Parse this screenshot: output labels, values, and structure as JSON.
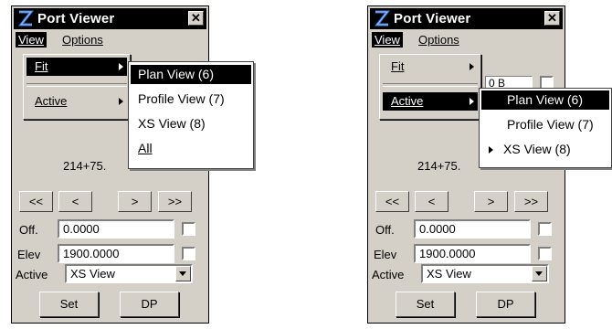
{
  "app": {
    "title": "Port Viewer",
    "close_glyph": "✕",
    "icon": "port-viewer-logo-icon"
  },
  "menu": {
    "view": "View",
    "options": "Options"
  },
  "view_menu": {
    "fit": "Fit",
    "active": "Active"
  },
  "submenu": {
    "plan": "Plan View (6)",
    "profile": "Profile View (7)",
    "xs": "XS View (8)",
    "all": "All"
  },
  "station_value": "214+75.",
  "partial_field_text": "0 B",
  "nav": {
    "first": "<<",
    "prev": "<",
    "next": ">",
    "last": ">>"
  },
  "offset": {
    "label": "Off.",
    "value": "0.0000"
  },
  "elevation": {
    "label": "Elev",
    "value": "1900.0000"
  },
  "active_view": {
    "label": "Active",
    "value": "XS View"
  },
  "buttons": {
    "set": "Set",
    "dp": "DP"
  }
}
